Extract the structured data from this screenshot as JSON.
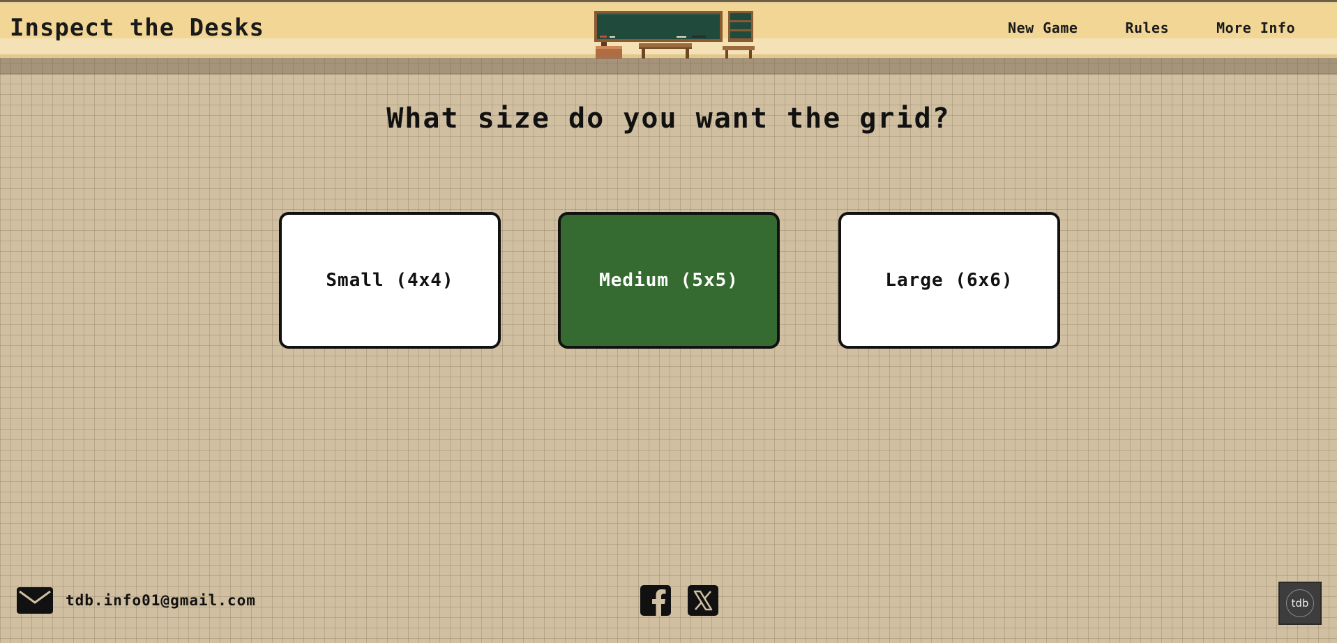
{
  "header": {
    "title": "Inspect the Desks",
    "nav": [
      {
        "label": "New Game"
      },
      {
        "label": "Rules"
      },
      {
        "label": "More Info"
      }
    ]
  },
  "main": {
    "question": "What size do you want the grid?",
    "options": [
      {
        "label": "Small (4x4)",
        "selected": false
      },
      {
        "label": "Medium (5x5)",
        "selected": true
      },
      {
        "label": "Large (6x6)",
        "selected": false
      }
    ]
  },
  "footer": {
    "email": "tdb.info01@gmail.com",
    "social": [
      {
        "icon": "facebook-icon"
      },
      {
        "icon": "x-icon"
      }
    ],
    "badge": "tdb"
  },
  "colors": {
    "background": "#d1bfa1",
    "header": "#f1d696",
    "selected_option": "#356b30",
    "option": "#ffffff",
    "text": "#111111",
    "badge": "#3d3d3d"
  }
}
